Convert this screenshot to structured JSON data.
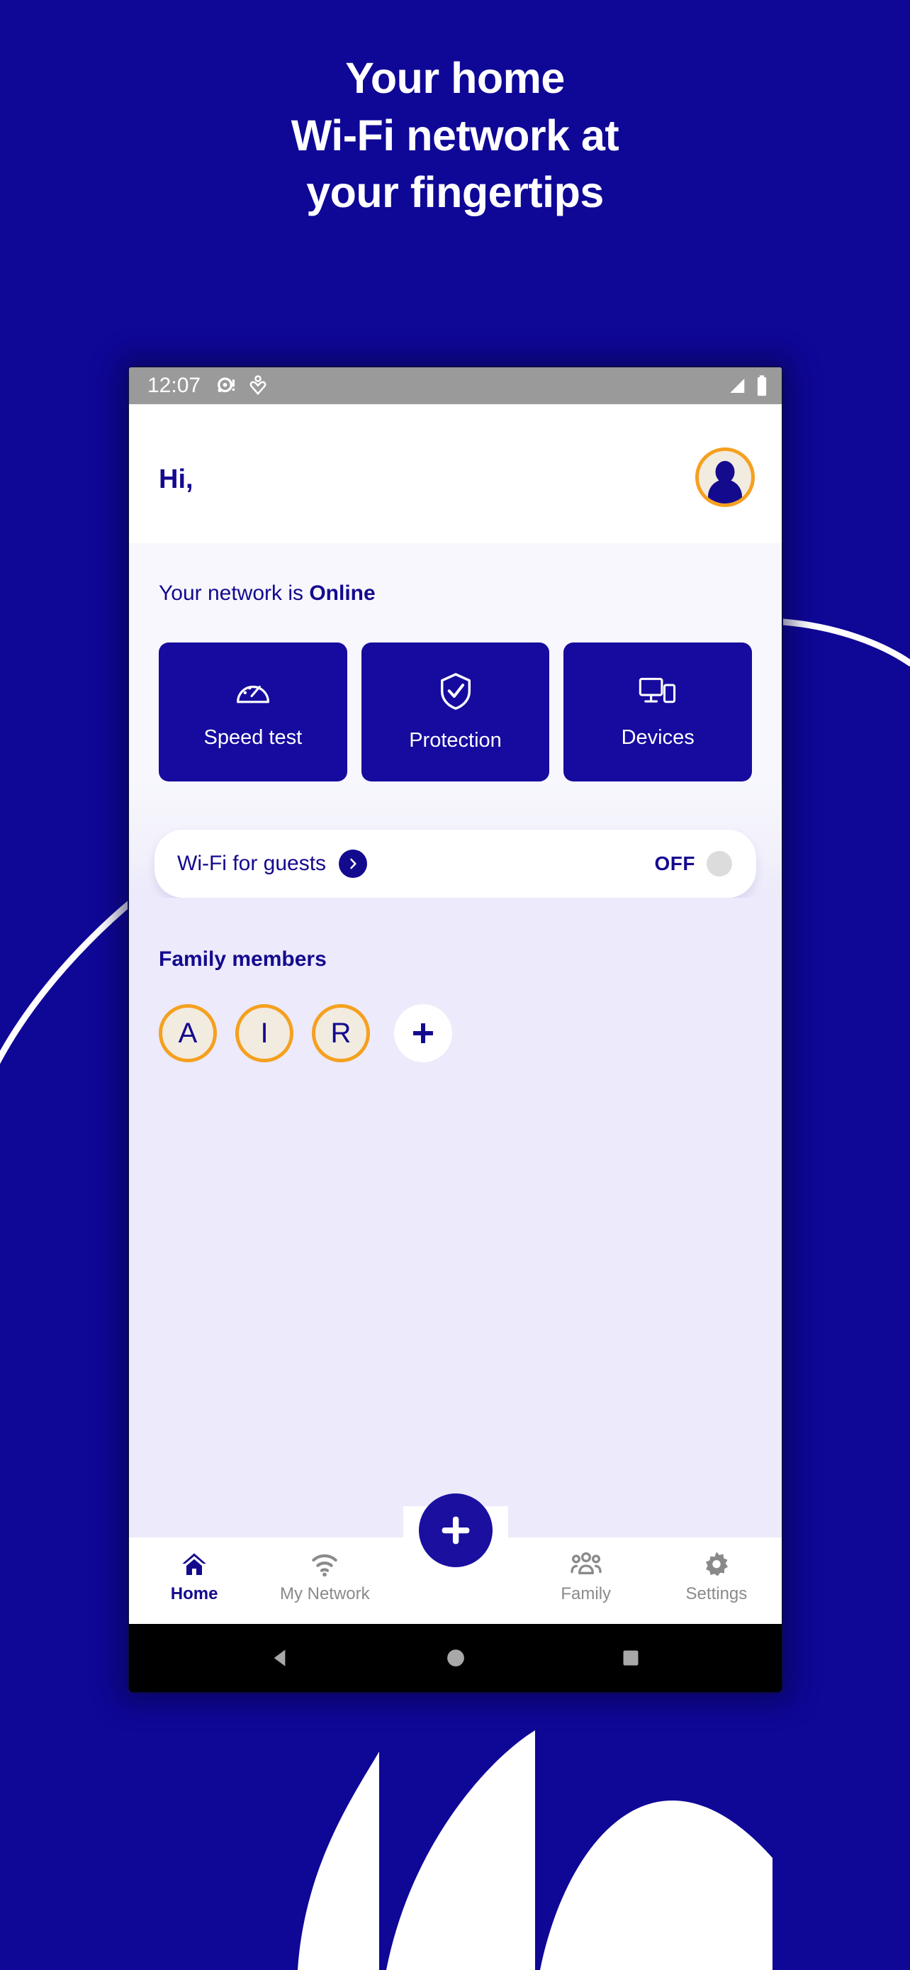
{
  "promo": {
    "headline_lines": [
      "Your home",
      "Wi-Fi network at",
      "your fingertips"
    ],
    "background_color": "#0f0796",
    "accent_color": "#F5A01E",
    "brand_blue": "#140a8e"
  },
  "phone": {
    "statusbar": {
      "time": "12:07",
      "icons_left": [
        "notification-dot-icon",
        "heart-pin-icon"
      ],
      "icons_right": [
        "signal-icon",
        "battery-icon"
      ],
      "background_color": "#9a9a9a"
    },
    "header": {
      "greeting": "Hi,",
      "avatar_icon": "user-avatar-icon"
    },
    "network": {
      "prefix": "Your network is ",
      "state": "Online"
    },
    "quick_actions": [
      {
        "label": "Speed test",
        "icon": "speedometer-icon"
      },
      {
        "label": "Protection",
        "icon": "shield-check-icon"
      },
      {
        "label": "Devices",
        "icon": "devices-icon"
      }
    ],
    "guest_wifi": {
      "label": "Wi-Fi for guests",
      "chevron_icon": "chevron-right-icon",
      "toggle_state": "OFF"
    },
    "family": {
      "title": "Family members",
      "members": [
        {
          "initial": "A"
        },
        {
          "initial": "I"
        },
        {
          "initial": "R"
        }
      ],
      "add_label": "+",
      "add_icon": "plus-icon"
    },
    "bottom_nav": {
      "fab_icon": "plus-icon",
      "items": [
        {
          "label": "Home",
          "icon": "home-icon",
          "active": true
        },
        {
          "label": "My Network",
          "icon": "wifi-icon",
          "active": false
        },
        {
          "label": "Family",
          "icon": "people-icon",
          "active": false
        },
        {
          "label": "Settings",
          "icon": "gear-icon",
          "active": false
        }
      ]
    },
    "android_nav": {
      "back_icon": "triangle-back-icon",
      "home_icon": "circle-home-icon",
      "recents_icon": "square-recents-icon"
    }
  }
}
